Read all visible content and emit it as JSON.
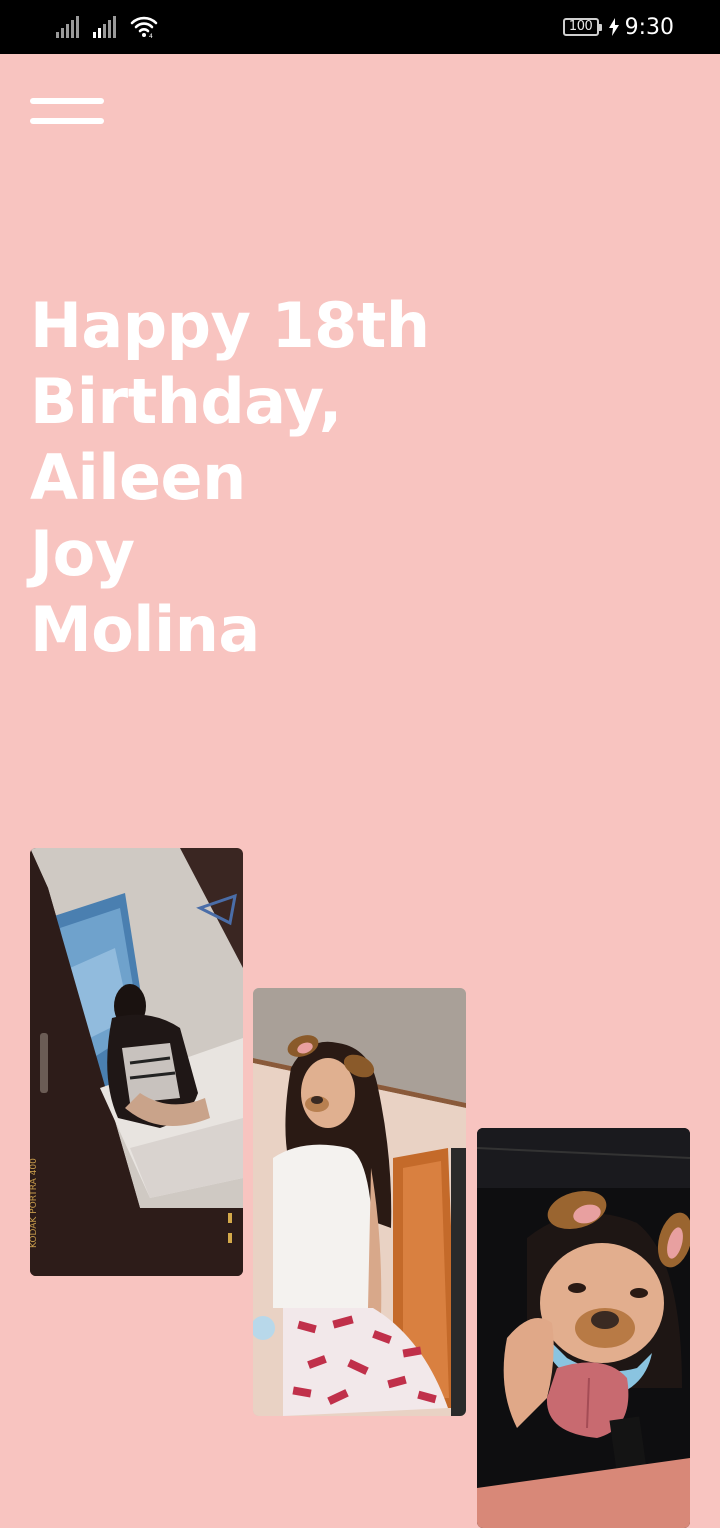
{
  "status_bar": {
    "battery": "100",
    "time": "9:30",
    "icons": [
      "signal-icon",
      "signal-icon",
      "wifi-icon",
      "battery-icon",
      "charging-icon"
    ]
  },
  "header": {
    "menu_icon": "hamburger-menu-icon"
  },
  "main": {
    "headline_lines": [
      "Happy 18th",
      "Birthday,",
      "Aileen",
      "Joy",
      "Molina"
    ]
  },
  "gallery": {
    "photos": [
      {
        "description_icon": "photo-girl-sitting-mirror",
        "film_text": "KODAK PORTRA 400"
      },
      {
        "description_icon": "photo-girl-dog-filter-standing"
      },
      {
        "description_icon": "photo-girl-dog-filter-closeup"
      }
    ]
  },
  "colors": {
    "background": "#f8c4c0",
    "text": "#ffffff",
    "status_bar": "#000000"
  }
}
